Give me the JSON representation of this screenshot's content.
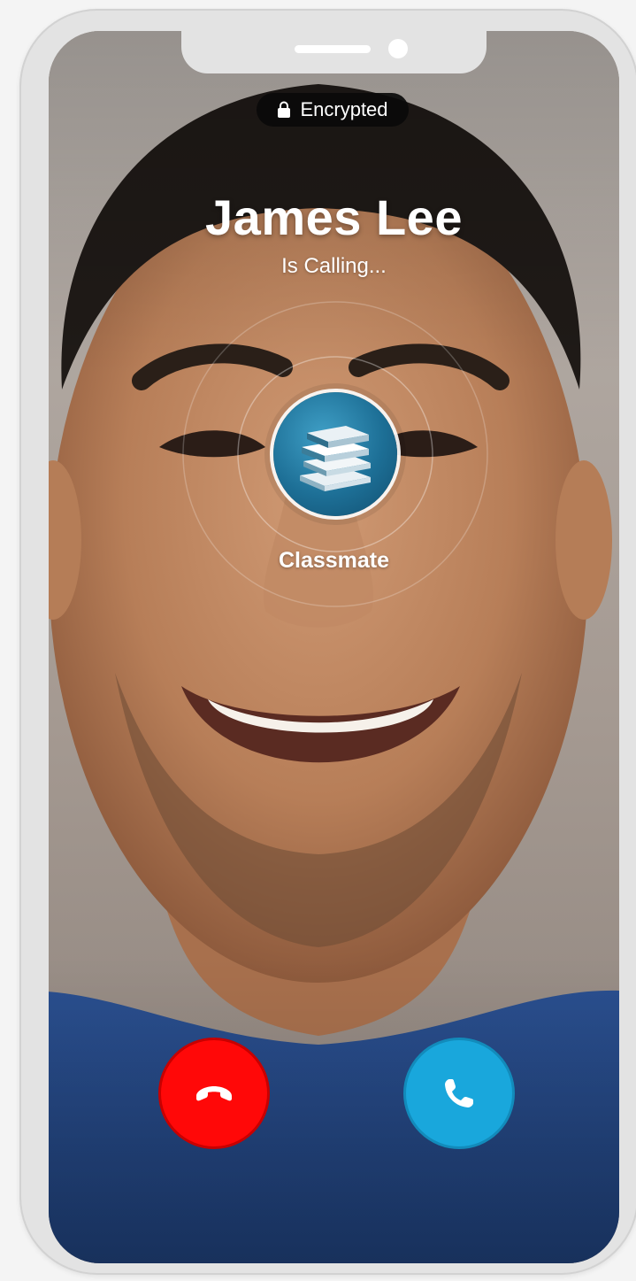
{
  "status_pill": {
    "icon": "lock-icon",
    "label": "Encrypted"
  },
  "caller": {
    "name": "James Lee",
    "status": "Is Calling..."
  },
  "contact": {
    "avatar_icon": "books-icon",
    "category": "Classmate"
  },
  "actions": {
    "decline": {
      "icon": "phone-hangup-icon",
      "color": "#ff0808"
    },
    "accept": {
      "icon": "phone-icon",
      "color": "#19a7dc"
    }
  }
}
